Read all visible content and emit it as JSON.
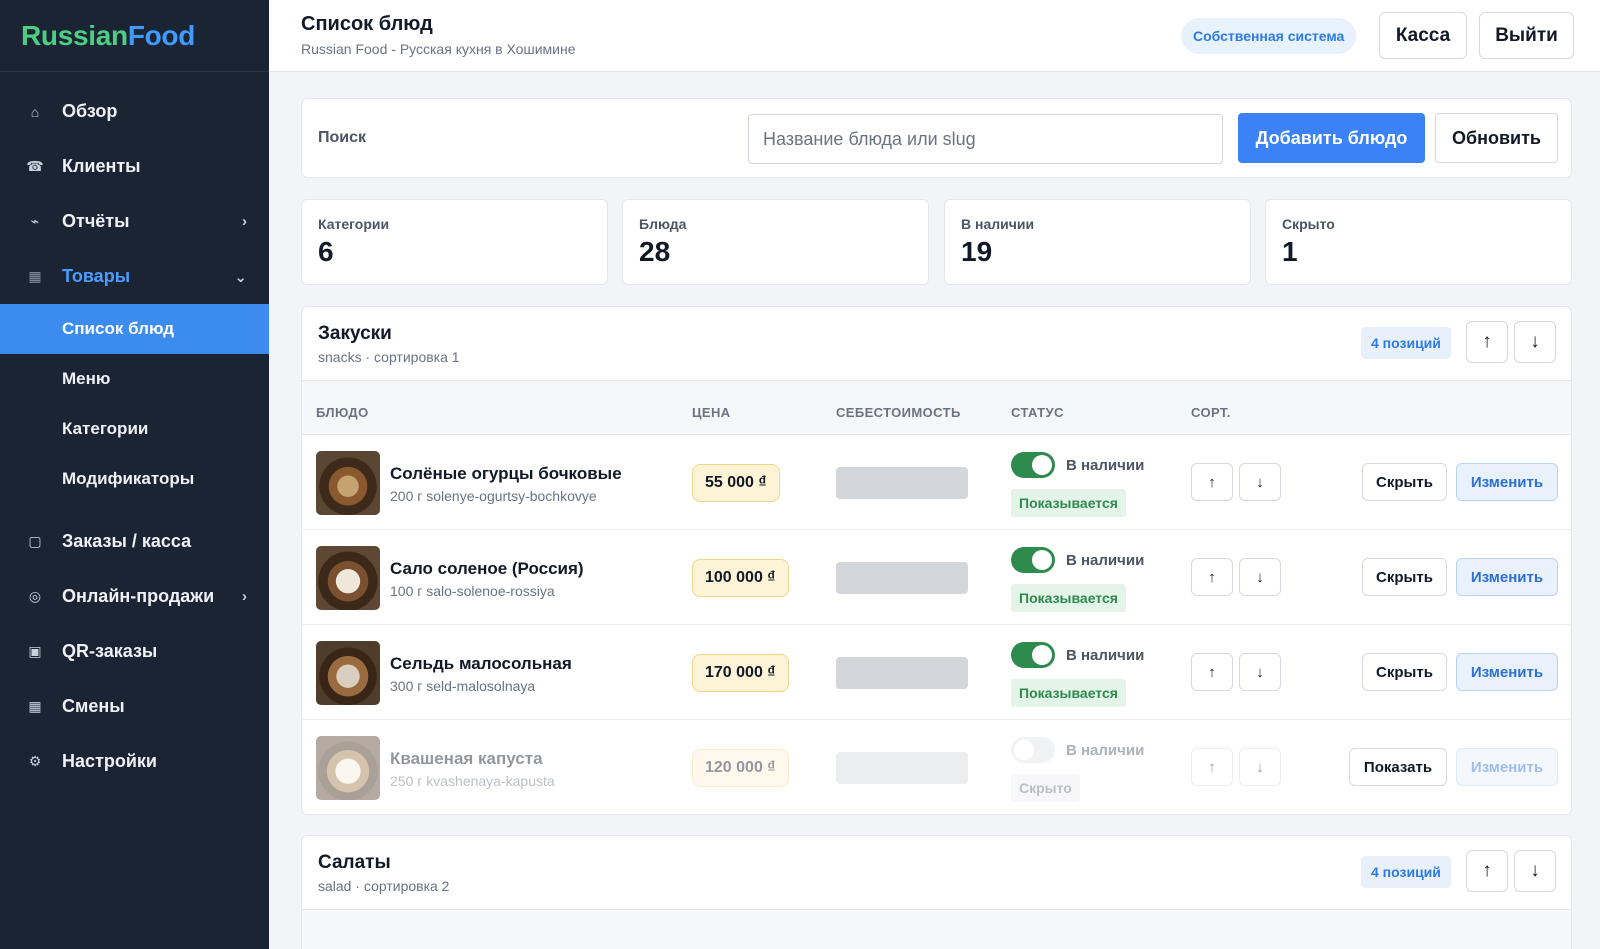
{
  "brand": {
    "part1": "Russian",
    "part2": "Food"
  },
  "sidebar": {
    "items": [
      {
        "label": "Обзор",
        "icon": "home-icon",
        "glyph": "⌂"
      },
      {
        "label": "Клиенты",
        "icon": "clients-icon",
        "glyph": "☎"
      },
      {
        "label": "Отчёты",
        "icon": "reports-icon",
        "glyph": "⌁",
        "chevron": "›"
      },
      {
        "label": "Товары",
        "icon": "products-icon",
        "glyph": "▦",
        "chevron": "⌄",
        "active": true
      },
      {
        "label": "Заказы / касса",
        "icon": "orders-icon",
        "glyph": "▢"
      },
      {
        "label": "Онлайн-продажи",
        "icon": "online-sales-icon",
        "glyph": "◎",
        "chevron": "›"
      },
      {
        "label": "QR-заказы",
        "icon": "qr-icon",
        "glyph": "▣"
      },
      {
        "label": "Смены",
        "icon": "shifts-icon",
        "glyph": "▦"
      },
      {
        "label": "Настройки",
        "icon": "settings-icon",
        "glyph": "⚙"
      }
    ],
    "subitems": [
      {
        "label": "Список блюд",
        "selected": true
      },
      {
        "label": "Меню"
      },
      {
        "label": "Категории"
      },
      {
        "label": "Модификаторы"
      }
    ]
  },
  "header": {
    "title": "Список блюд",
    "subtitle": "Russian Food - Русская кухня в Хошимине",
    "system_badge": "Собственная система",
    "kassa_label": "Касса",
    "exit_label": "Выйти"
  },
  "search": {
    "label": "Поиск",
    "placeholder": "Название блюда или slug",
    "value": "",
    "add_label": "Добавить блюдо",
    "refresh_label": "Обновить"
  },
  "stats": [
    {
      "label": "Категории",
      "value": "6"
    },
    {
      "label": "Блюда",
      "value": "28"
    },
    {
      "label": "В наличии",
      "value": "19"
    },
    {
      "label": "Скрыто",
      "value": "1"
    }
  ],
  "table_headers": {
    "dish": "БЛЮДО",
    "price": "ЦЕНА",
    "cost": "СЕБЕСТОИМОСТЬ",
    "status": "СТАТУС",
    "sort": "СОРТ."
  },
  "arrows": {
    "up": "↑",
    "down": "↓"
  },
  "sections": [
    {
      "title": "Закуски",
      "subtitle": "snacks · сортировка 1",
      "count": "4 позиций",
      "rows": [
        {
          "name": "Солёные огурцы бочковые",
          "meta": "200 г  solenye-ogurtsy-bochkovye",
          "price": "55 000 ₫",
          "availability": "В наличии",
          "available": true,
          "visibility": "Показывается",
          "action": "Скрыть",
          "edit": "Изменить"
        },
        {
          "name": "Сало соленое (Россия)",
          "meta": "100 г  salo-solenoe-rossiya",
          "price": "100 000 ₫",
          "availability": "В наличии",
          "available": true,
          "visibility": "Показывается",
          "action": "Скрыть",
          "edit": "Изменить"
        },
        {
          "name": "Сельдь малосольная",
          "meta": "300 г  seld-malosolnaya",
          "price": "170 000 ₫",
          "availability": "В наличии",
          "available": true,
          "visibility": "Показывается",
          "action": "Скрыть",
          "edit": "Изменить"
        },
        {
          "name": "Квашеная капуста",
          "meta": "250 г  kvashenaya-kapusta",
          "price": "120 000 ₫",
          "availability": "В наличии",
          "available": false,
          "visibility": "Скрыто",
          "action": "Показать",
          "edit": "Изменить"
        }
      ]
    },
    {
      "title": "Салаты",
      "subtitle": "salad · сортировка 2",
      "count": "4 позиций"
    }
  ]
}
